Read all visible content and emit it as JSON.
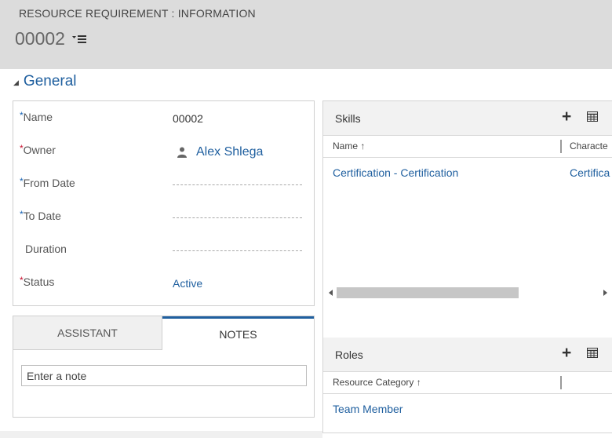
{
  "header": {
    "entity_type": "RESOURCE REQUIREMENT : INFORMATION",
    "record_title": "00002"
  },
  "section": {
    "title": "General"
  },
  "form": {
    "name_label": "Name",
    "name_value": "00002",
    "owner_label": "Owner",
    "owner_value": "Alex Shlega",
    "from_date_label": "From Date",
    "to_date_label": "To Date",
    "duration_label": "Duration",
    "status_label": "Status",
    "status_value": "Active"
  },
  "tabs": {
    "assistant_label": "ASSISTANT",
    "notes_label": "NOTES",
    "note_placeholder": "Enter a note"
  },
  "skills_grid": {
    "title": "Skills",
    "columns": [
      "Name ↑",
      "Characte"
    ],
    "rows": [
      [
        "Certification - Certification",
        "Certifica"
      ]
    ]
  },
  "roles_grid": {
    "title": "Roles",
    "columns": [
      "Resource Category ↑"
    ],
    "rows": [
      [
        "Team Member"
      ]
    ]
  },
  "colors": {
    "link": "#1f5f9f",
    "required_business": "#1a64b4",
    "required": "#c8102e",
    "header_bg": "#dcdcdc"
  },
  "icons": {
    "plus": "+",
    "title_menu": "list-menu-icon",
    "grid_view": "grid-view-icon",
    "user": "user-icon"
  }
}
